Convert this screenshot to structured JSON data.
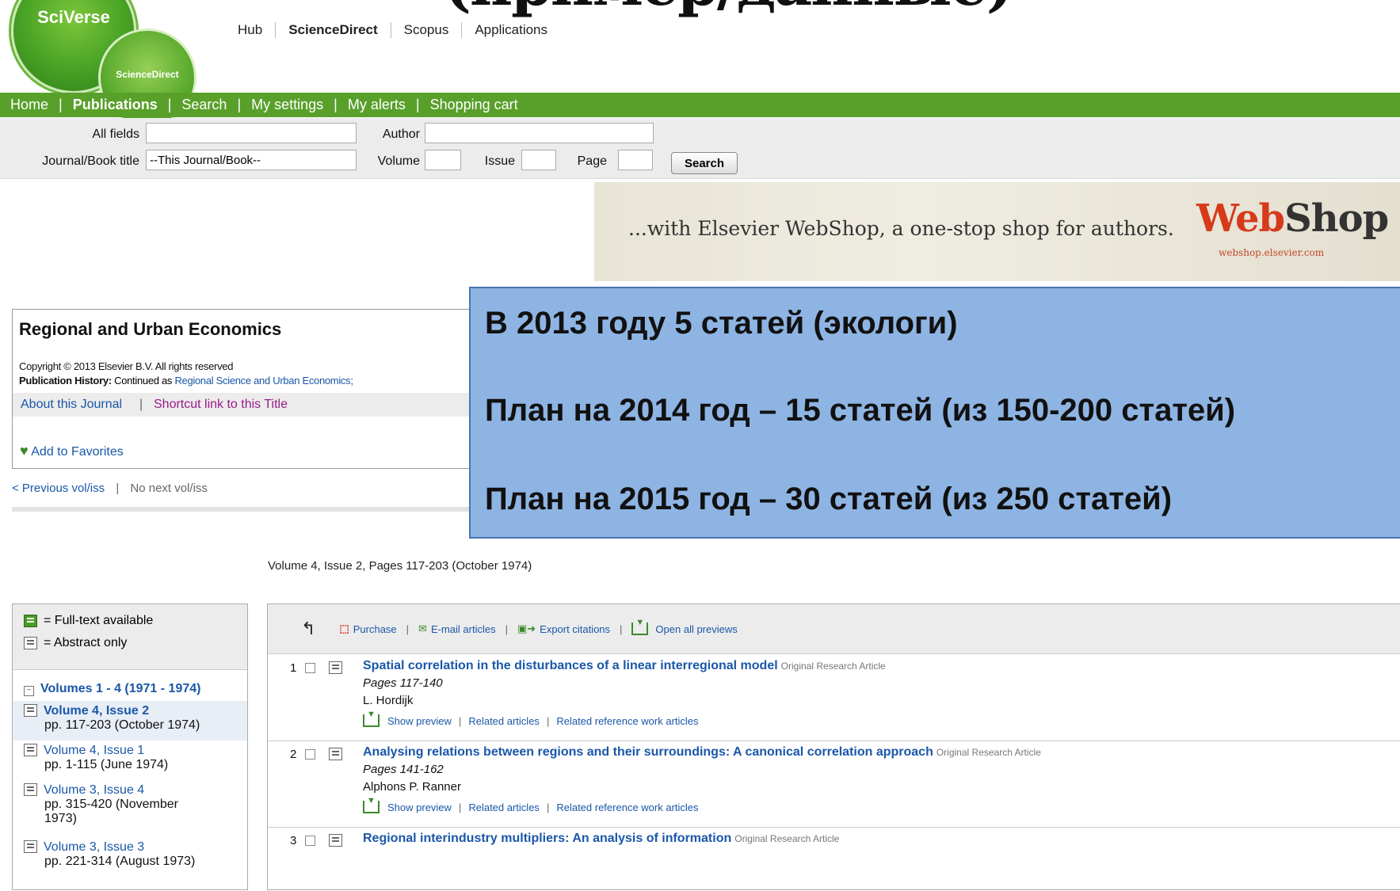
{
  "slide_fragment": "(пример/данные)",
  "logo": {
    "main": "SciVerse",
    "sub": "ScienceDirect"
  },
  "top_nav": [
    "Hub",
    "ScienceDirect",
    "Scopus",
    "Applications"
  ],
  "green_nav": [
    "Home",
    "Publications",
    "Search",
    "My settings",
    "My alerts",
    "Shopping cart"
  ],
  "search": {
    "all_fields_label": "All fields",
    "author_label": "Author",
    "journal_label": "Journal/Book title",
    "journal_value": "--This Journal/Book--",
    "volume_label": "Volume",
    "issue_label": "Issue",
    "page_label": "Page",
    "button": "Search"
  },
  "banner": {
    "text": "...with Elsevier WebShop, a one-stop shop for authors.",
    "logo_a": "Web",
    "logo_b": "Shop",
    "url": "webshop.elsevier.com"
  },
  "journal": {
    "title": "Regional and Urban Economics",
    "copyright": "Copyright © 2013 Elsevier B.V. All rights reserved",
    "history_label": "Publication History:",
    "history_text": "Continued as",
    "history_link": "Regional Science and Urban Economics;",
    "about": "About this Journal",
    "shortcut": "Shortcut link to this Title",
    "favorites": "Add to Favorites",
    "prev": "< Previous vol/iss",
    "next": "No next vol/iss"
  },
  "overlay": [
    "В 2013 году  5 статей (экологи)",
    "План на 2014 год – 15 статей (из 150-200 статей)",
    "План на 2015 год – 30 статей (из 250 статей)"
  ],
  "volume_line": "Volume 4, Issue 2, Pages 117-203 (October 1974)",
  "legend": {
    "full": "= Full-text available",
    "abstract": "= Abstract only"
  },
  "volume_group": "Volumes 1 - 4 (1971 - 1974)",
  "volumes": [
    {
      "title": "Volume 4, Issue 2",
      "detail": "pp. 117-203 (October 1974)"
    },
    {
      "title": "Volume 4, Issue 1",
      "detail": "pp. 1-115 (June 1974)"
    },
    {
      "title": "Volume 3, Issue 4",
      "detail": "pp. 315-420 (November 1973)"
    },
    {
      "title": "Volume 3, Issue 3",
      "detail": "pp. 221-314 (August 1973)"
    }
  ],
  "toolbar": {
    "purchase": "Purchase",
    "email": "E-mail articles",
    "export": "Export citations",
    "open": "Open all previews"
  },
  "articles": [
    {
      "num": "1",
      "title": "Spatial correlation in the disturbances of a linear interregional model",
      "type": "Original Research Article",
      "pages": "Pages 117-140",
      "author": "L. Hordijk"
    },
    {
      "num": "2",
      "title": "Analysing relations between regions and their surroundings: A canonical correlation approach",
      "type": "Original Research Article",
      "pages": "Pages 141-162",
      "author": "Alphons P. Ranner"
    },
    {
      "num": "3",
      "title": "Regional interindustry multipliers: An analysis of information",
      "type": "Original Research Article",
      "pages": "",
      "author": ""
    }
  ],
  "article_actions": {
    "preview": "Show preview",
    "related": "Related articles",
    "related_ref": "Related reference work articles"
  },
  "colors": {
    "green_bar": "#58a02a",
    "overlay_bg": "#8eb4e3",
    "link": "#1a57a8"
  }
}
